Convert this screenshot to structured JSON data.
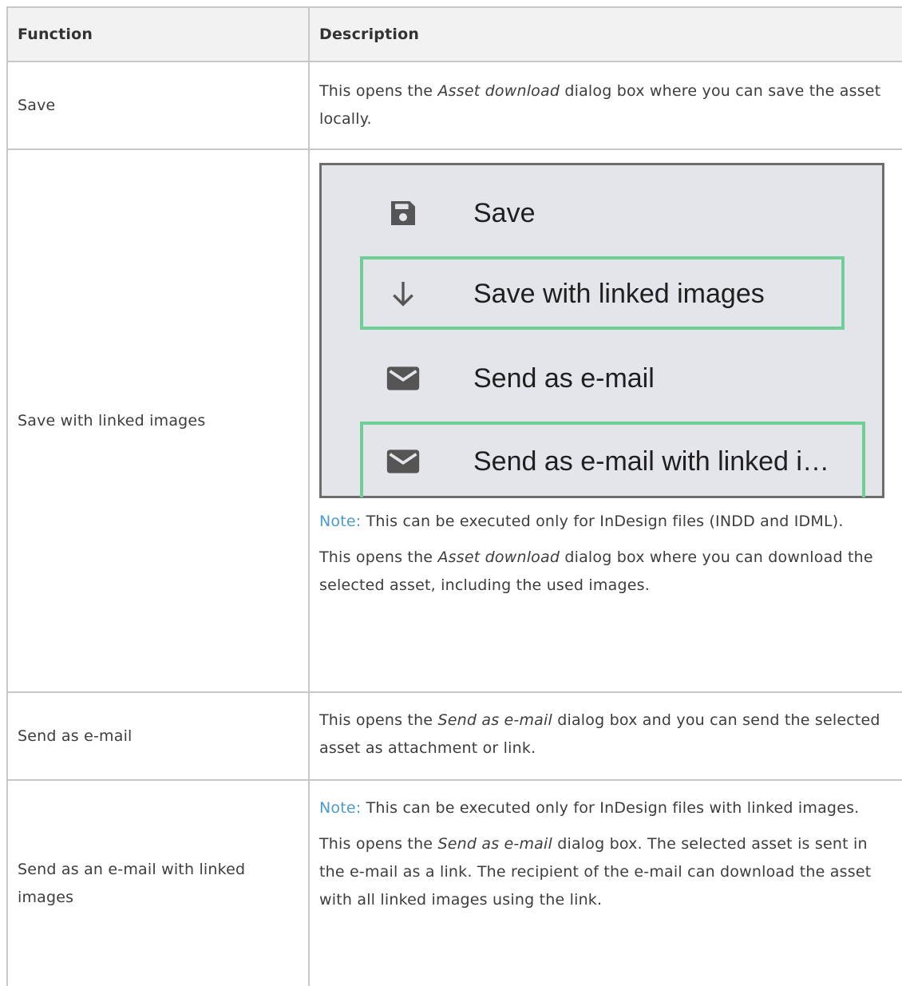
{
  "header": {
    "col1": "Function",
    "col2": "Description"
  },
  "rows": [
    {
      "function": "Save",
      "desc_pre": "This opens the ",
      "desc_em": "Asset download",
      "desc_post": " dialog box where you can save the asset locally."
    },
    {
      "function": "Save with linked images",
      "menu": {
        "items": [
          {
            "label": "Save",
            "icon": "save-icon"
          },
          {
            "label": "Save with linked images",
            "icon": "arrow-down-icon",
            "highlighted": true
          },
          {
            "label": "Send as e-mail",
            "icon": "mail-icon"
          },
          {
            "label": "Send as e-mail with linked i…",
            "icon": "mail-icon",
            "highlighted": true
          }
        ],
        "highlight_color": "#6fcf97"
      },
      "note_label": "Note:",
      "note_text": " This can be executed only for InDesign files (INDD and IDML).",
      "desc_pre": "This opens the ",
      "desc_em": "Asset download",
      "desc_post": " dialog box where you can download the selected asset, including the used images."
    },
    {
      "function": "Send as e-mail",
      "desc_pre": "This opens the ",
      "desc_em": "Send as e-mail",
      "desc_post": " dialog box and you can send the selected asset as attachment or link."
    },
    {
      "function": "Send as an e-mail with linked images",
      "note_label": "Note:",
      "note_text": " This can be executed only for InDesign files with linked images.",
      "desc_pre": "This opens the ",
      "desc_em": "Send as e-mail",
      "desc_post": " dialog box. The selected asset is sent in the e-mail as a link. The recipient of the e-mail can download the asset with all linked images using the link."
    }
  ],
  "colors": {
    "note": "#4a9ccc",
    "header_bg": "#f2f2f2",
    "grid": "#c8c8c8"
  }
}
